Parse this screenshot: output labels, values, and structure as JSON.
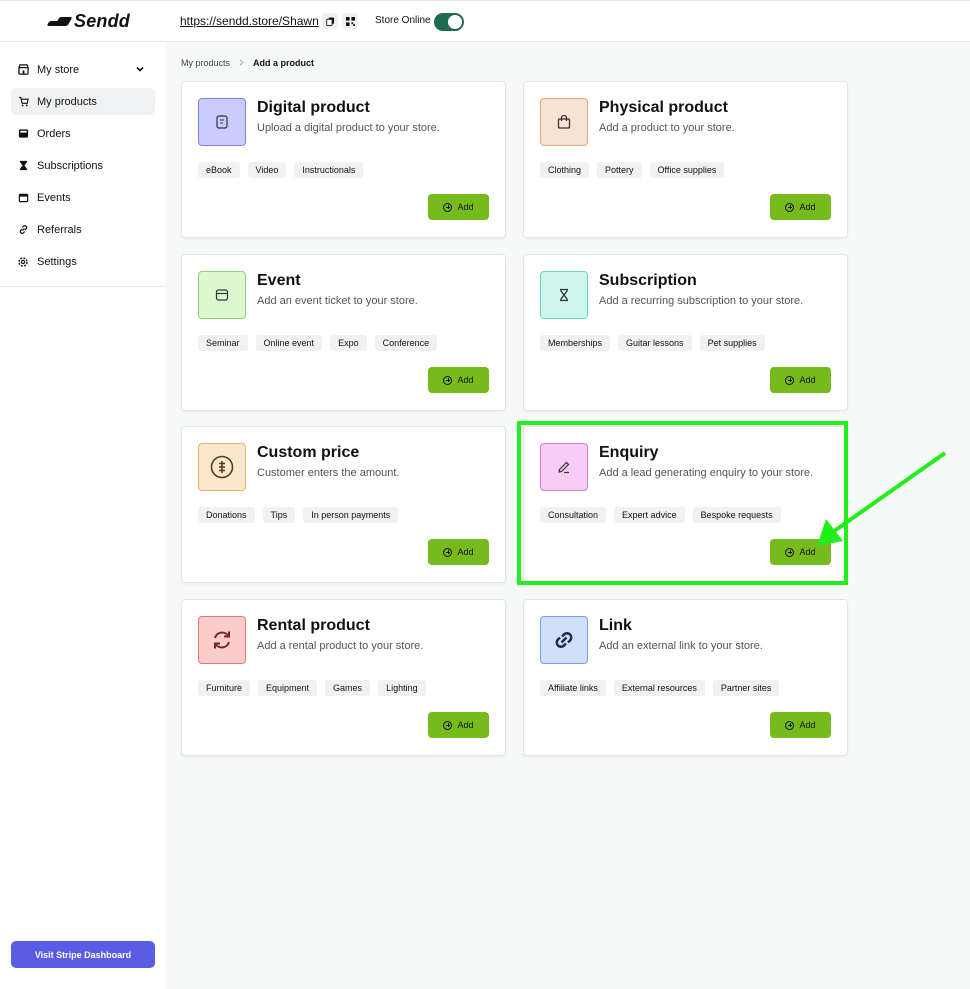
{
  "topbar": {
    "logo_text": "Sendd",
    "store_url": "https://sendd.store/Shawn",
    "store_status_label": "Store Online",
    "store_online": true
  },
  "sidebar": {
    "items": [
      {
        "label": "My store",
        "icon": "store-icon",
        "expandable": true
      },
      {
        "label": "My products",
        "icon": "cart-icon",
        "active": true
      },
      {
        "label": "Orders",
        "icon": "inbox-icon"
      },
      {
        "label": "Subscriptions",
        "icon": "hourglass-icon"
      },
      {
        "label": "Events",
        "icon": "calendar-icon"
      },
      {
        "label": "Referrals",
        "icon": "link-icon"
      },
      {
        "label": "Settings",
        "icon": "gear-icon"
      }
    ],
    "stripe_button": "Visit Stripe Dashboard"
  },
  "breadcrumb": {
    "parent": "My products",
    "current": "Add a product"
  },
  "cards": [
    {
      "title": "Digital product",
      "description": "Upload a digital product to your store.",
      "tags": [
        "eBook",
        "Video",
        "Instructionals"
      ],
      "icon": "digital-file-icon",
      "icon_bg": "#c9cdfb",
      "icon_border": "#7b82e8",
      "add_label": "Add"
    },
    {
      "title": "Physical product",
      "description": "Add a product to your store.",
      "tags": [
        "Clothing",
        "Pottery",
        "Office supplies"
      ],
      "icon": "shopping-bag-icon",
      "icon_bg": "#fbe3d4",
      "icon_border": "#e8a77b",
      "add_label": "Add"
    },
    {
      "title": "Event",
      "description": "Add an event ticket to your store.",
      "tags": [
        "Seminar",
        "Online event",
        "Expo",
        "Conference"
      ],
      "icon": "calendar-icon",
      "icon_bg": "#dcf8cf",
      "icon_border": "#8fd572",
      "add_label": "Add"
    },
    {
      "title": "Subscription",
      "description": "Add a recurring subscription to your store.",
      "tags": [
        "Memberships",
        "Guitar lessons",
        "Pet supplies"
      ],
      "icon": "hourglass-icon",
      "icon_bg": "#cdf7ec",
      "icon_border": "#6fd4b8",
      "add_label": "Add"
    },
    {
      "title": "Custom price",
      "description": "Customer enters the amount.",
      "tags": [
        "Donations",
        "Tips",
        "In person payments"
      ],
      "icon": "coin-icon",
      "icon_bg": "#fbe7cc",
      "icon_border": "#e5b56d",
      "add_label": "Add"
    },
    {
      "title": "Enquiry",
      "description": "Add a lead generating enquiry to your store.",
      "tags": [
        "Consultation",
        "Expert advice",
        "Bespoke requests"
      ],
      "icon": "pencil-icon",
      "icon_bg": "#f7ccf7",
      "icon_border": "#d77bd8",
      "add_label": "Add"
    },
    {
      "title": "Rental product",
      "description": "Add a rental product to your store.",
      "tags": [
        "Furniture",
        "Equipment",
        "Games",
        "Lighting"
      ],
      "icon": "refresh-icon",
      "icon_bg": "#fbcccc",
      "icon_border": "#e27c7c",
      "add_label": "Add"
    },
    {
      "title": "Link",
      "description": "Add an external link to your store.",
      "tags": [
        "Affiliate links",
        "External resources",
        "Partner sites"
      ],
      "icon": "chain-link-icon",
      "icon_bg": "#cfe0fb",
      "icon_border": "#7b9fe8",
      "add_label": "Add"
    }
  ],
  "annotation": {
    "highlight_color": "#22ee1a",
    "highlighted_card": "Enquiry"
  },
  "colors": {
    "add_button": "#76bb1b",
    "stripe_button": "#5b5ce6",
    "toggle_on": "#1e6b4f"
  }
}
